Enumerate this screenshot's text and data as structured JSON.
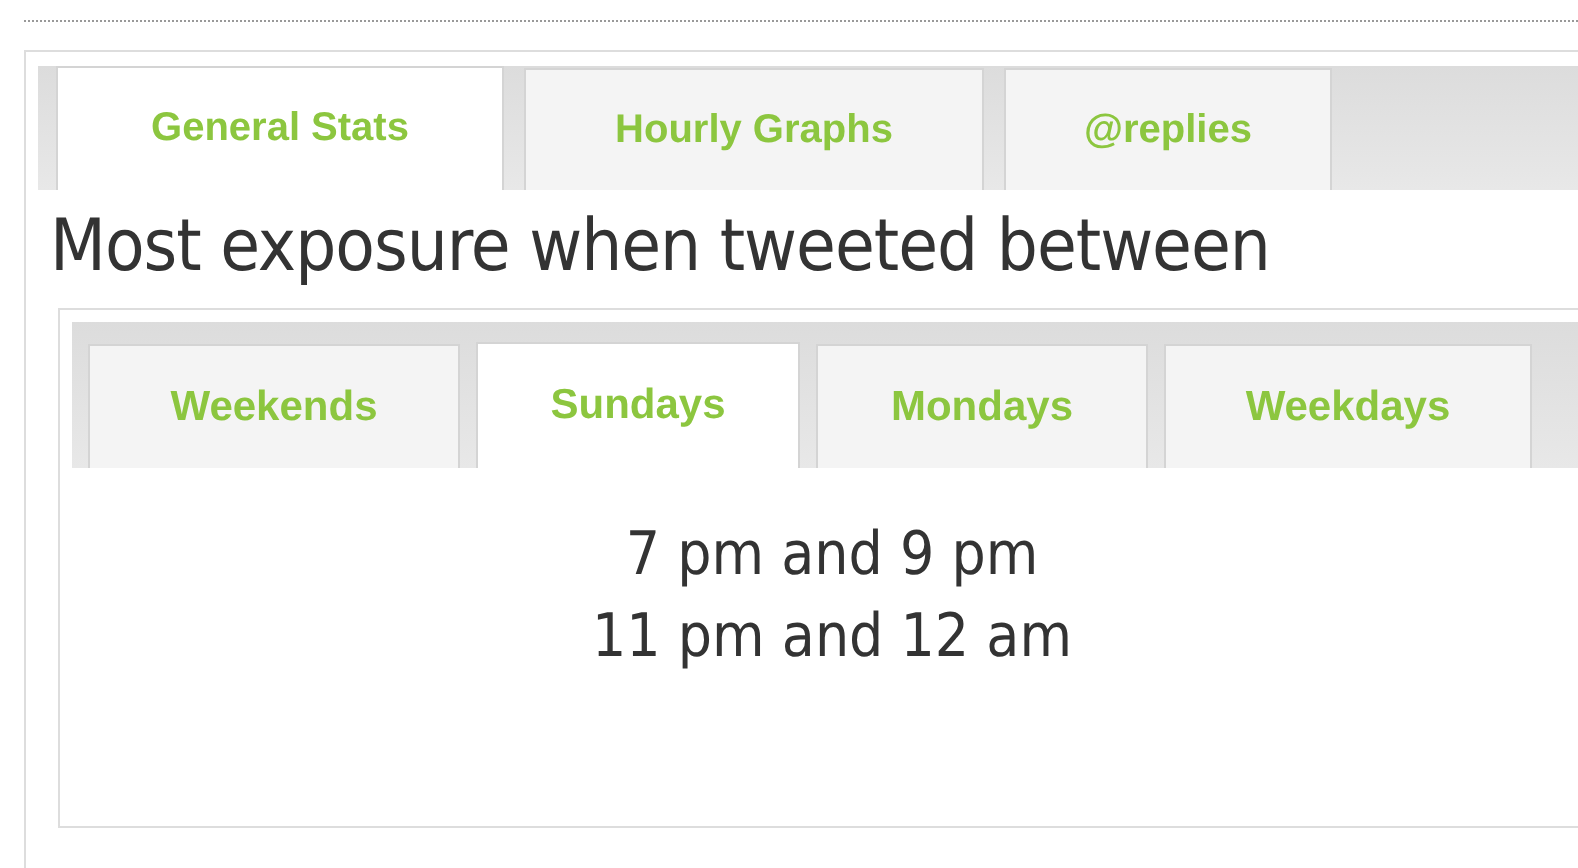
{
  "tabs": [
    {
      "label": "General Stats",
      "selected": true
    },
    {
      "label": "Hourly Graphs",
      "selected": false
    },
    {
      "label": "@replies",
      "selected": false
    }
  ],
  "heading": "Most exposure when tweeted between",
  "day_tabs": [
    {
      "label": "Weekends",
      "selected": false
    },
    {
      "label": "Sundays",
      "selected": true
    },
    {
      "label": "Mondays",
      "selected": false
    },
    {
      "label": "Weekdays",
      "selected": false
    }
  ],
  "time_ranges": [
    "7 pm and 9 pm",
    "11 pm and 12 am"
  ]
}
